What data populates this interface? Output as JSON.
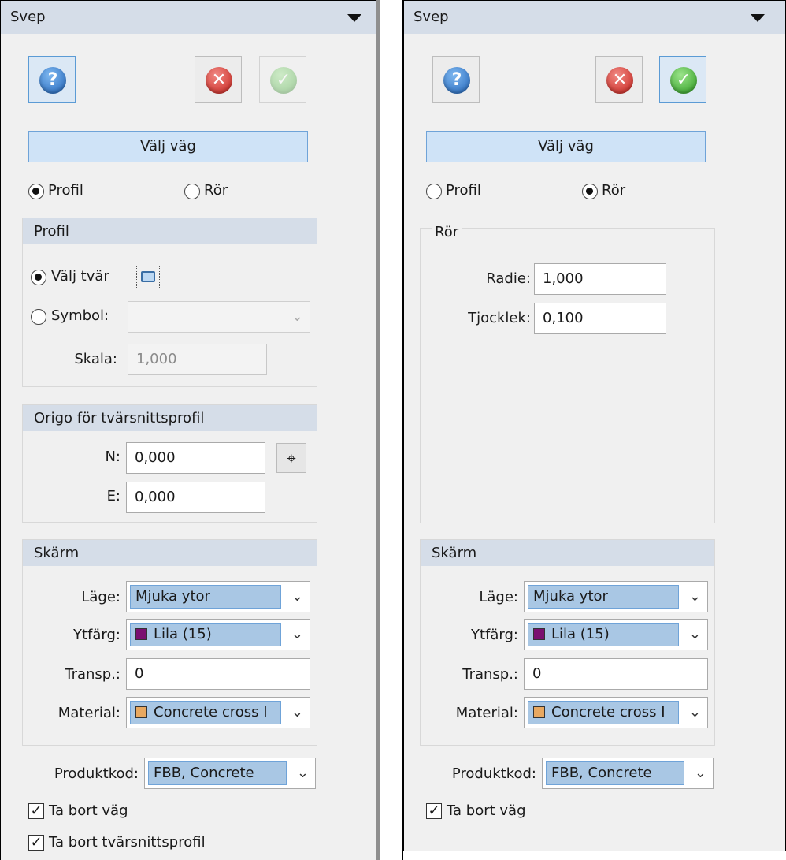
{
  "left": {
    "title": "Svep",
    "buttons": {
      "help_icon": "help-circle-icon",
      "cancel_icon": "cancel-circle-icon",
      "ok_icon": "ok-check-icon"
    },
    "select_road": "Välj väg",
    "radio_profile": "Profil",
    "radio_pipe": "Rör",
    "profile_group": {
      "title": "Profil",
      "select_cross": "Välj tvär",
      "symbol": "Symbol:",
      "scale_label": "Skala:",
      "scale_value": "1,000"
    },
    "origin_group": {
      "title": "Origo för tvärsnittsprofil",
      "n_label": "N:",
      "n_value": "0,000",
      "e_label": "E:",
      "e_value": "0,000"
    },
    "screen_group": {
      "title": "Skärm",
      "mode_label": "Läge:",
      "mode_value": "Mjuka ytor",
      "color_label": "Ytfärg:",
      "color_value": "Lila (15)",
      "transp_label": "Transp.:",
      "transp_value": "0",
      "material_label": "Material:",
      "material_value": "Concrete cross I"
    },
    "product_label": "Produktkod:",
    "product_value": "FBB, Concrete",
    "check_remove_road": "Ta bort väg",
    "check_remove_profile": "Ta bort tvärsnittsprofil"
  },
  "right": {
    "title": "Svep",
    "select_road": "Välj väg",
    "radio_profile": "Profil",
    "radio_pipe": "Rör",
    "pipe_group": {
      "title": "Rör",
      "radius_label": "Radie:",
      "radius_value": "1,000",
      "thickness_label": "Tjocklek:",
      "thickness_value": "0,100"
    },
    "screen_group": {
      "title": "Skärm",
      "mode_label": "Läge:",
      "mode_value": "Mjuka ytor",
      "color_label": "Ytfärg:",
      "color_value": "Lila (15)",
      "transp_label": "Transp.:",
      "transp_value": "0",
      "material_label": "Material:",
      "material_value": "Concrete cross I"
    },
    "product_label": "Produktkod:",
    "product_value": "FBB, Concrete",
    "check_remove_road": "Ta bort väg"
  },
  "colors": {
    "purple_swatch": "#7a1070",
    "material_swatch": "#e8a860",
    "header_bg": "#d5dde8",
    "accent": "#5b9bd5"
  }
}
